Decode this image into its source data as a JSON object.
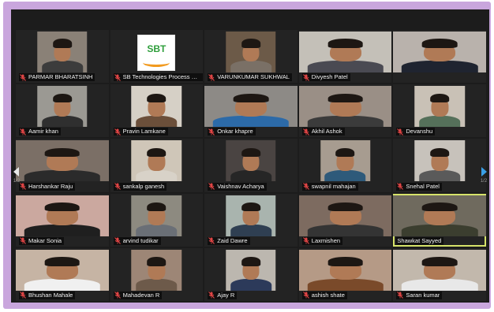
{
  "meeting": {
    "page_indicator_left": "1/2",
    "page_indicator_right": "1/2"
  },
  "logo": {
    "text": "SBT"
  },
  "participants": [
    {
      "name": "PARMAR BHARATSINH",
      "bg": "#8a8177",
      "shirt": "#3c3c3c",
      "muted": true
    },
    {
      "name": "SB Technologies Process D...",
      "bg": "#232323",
      "shirt": "#232323",
      "muted": true,
      "logo": true
    },
    {
      "name": "VARUNKUMAR SUKHWAL",
      "bg": "#6c5a48",
      "shirt": "#7a7066",
      "muted": true
    },
    {
      "name": "Divyesh Patel",
      "bg": "#c4c0b8",
      "shirt": "#4a4a52",
      "muted": true
    },
    {
      "name": "",
      "bg": "#b9b2ac",
      "shirt": "#1f2430",
      "muted": false
    },
    {
      "name": "Aamir khan",
      "bg": "#9b9993",
      "shirt": "#2f2f2f",
      "muted": true
    },
    {
      "name": "Pravin Lamkane",
      "bg": "#d6d0c6",
      "shirt": "#6b4f3a",
      "muted": true
    },
    {
      "name": "Onkar khapre",
      "bg": "#8d8a86",
      "shirt": "#2c6aa8",
      "muted": true
    },
    {
      "name": "Akhil Ashok",
      "bg": "#9a8f86",
      "shirt": "#3b3b3b",
      "muted": true
    },
    {
      "name": "Devanshu",
      "bg": "#c9c1b6",
      "shirt": "#55705a",
      "muted": true
    },
    {
      "name": "Harshankar Raju",
      "bg": "#7b6f66",
      "shirt": "#2b2b2b",
      "muted": true
    },
    {
      "name": "sankalp ganesh",
      "bg": "#cfc6b8",
      "shirt": "#d8d2c8",
      "muted": true
    },
    {
      "name": "Vaishnav Acharya",
      "bg": "#4a4442",
      "shirt": "#262626",
      "muted": true
    },
    {
      "name": "swapnil mahajan",
      "bg": "#a79c90",
      "shirt": "#2e5a7a",
      "muted": true
    },
    {
      "name": "Snehal Patel",
      "bg": "#c7c2bb",
      "shirt": "#5a5a5a",
      "muted": true
    },
    {
      "name": "Makar Sonia",
      "bg": "#cba89f",
      "shirt": "#1f1f1f",
      "muted": true
    },
    {
      "name": "arvind tudikar",
      "bg": "#8d8a80",
      "shirt": "#6a6f76",
      "muted": true
    },
    {
      "name": "Zaid Dawre",
      "bg": "#a9b4ae",
      "shirt": "#2f3f52",
      "muted": true
    },
    {
      "name": "Laxmishen",
      "bg": "#7d6b60",
      "shirt": "#343434",
      "muted": true
    },
    {
      "name": "Shawkat Sayyed",
      "bg": "#6f6a5e",
      "shirt": "#3b3e2f",
      "muted": false,
      "active": true
    },
    {
      "name": "Bhushan Mahale",
      "bg": "#c6b4a4",
      "shirt": "#f0f0f0",
      "muted": true
    },
    {
      "name": "Mahadevan R",
      "bg": "#9d8676",
      "shirt": "#6d5a4a",
      "muted": true
    },
    {
      "name": "Ajay R",
      "bg": "#bcb7af",
      "shirt": "#2c3a5a",
      "muted": true
    },
    {
      "name": "ashish shate",
      "bg": "#b59a86",
      "shirt": "#7a4a2a",
      "muted": true
    },
    {
      "name": "Saran kumar",
      "bg": "#c2b8ac",
      "shirt": "#e8e8e8",
      "muted": true
    }
  ]
}
